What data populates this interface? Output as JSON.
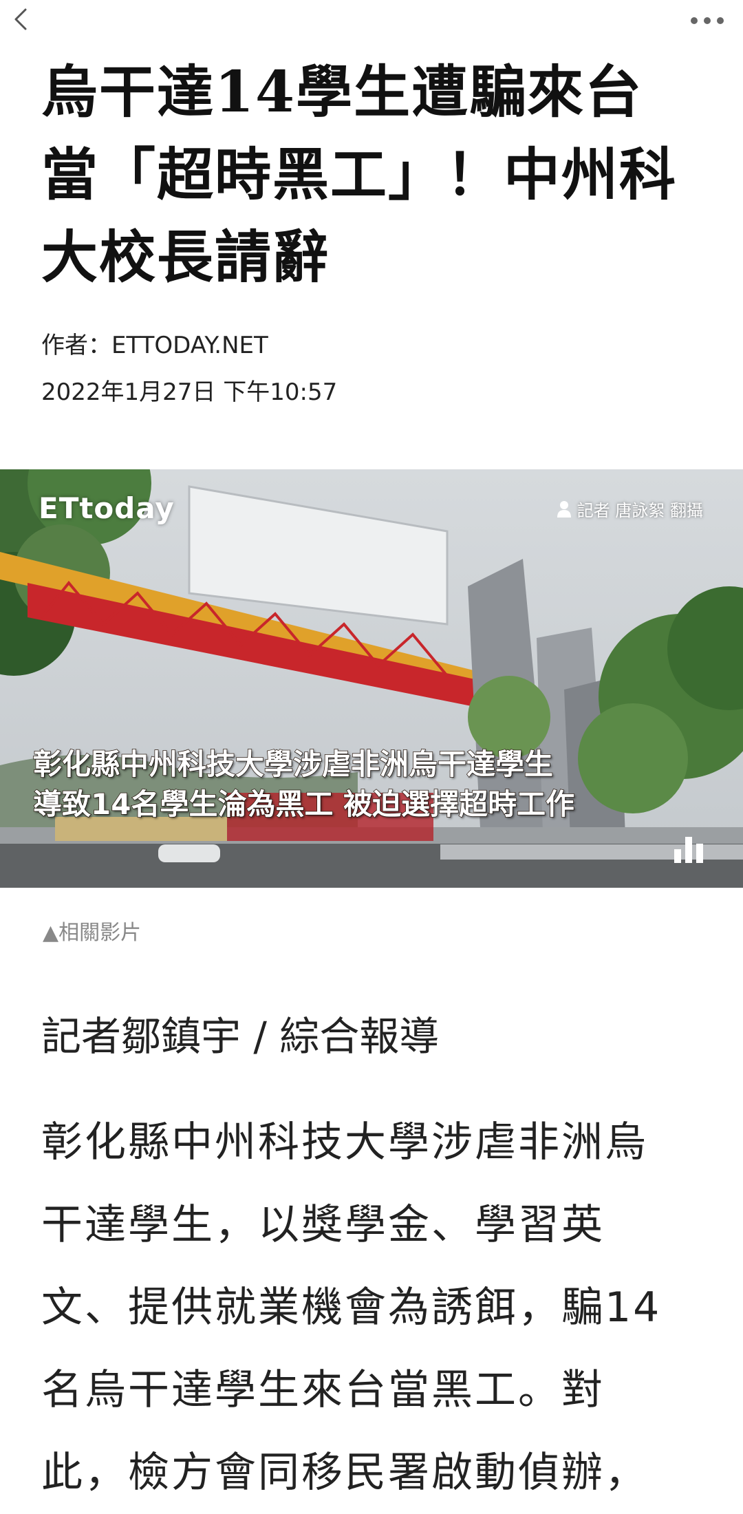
{
  "header": {
    "back_icon": "chevron-left-icon",
    "more_icon": "more-horizontal-icon"
  },
  "article": {
    "title_lines": [
      "烏干達14學生遭騙來台",
      "當「超時黑工」！中州科",
      "大校長請辭"
    ],
    "author": "作者：ETTODAY.NET",
    "date": "2022年1月27日 下午10:57"
  },
  "video": {
    "logo": "ETtoday",
    "credit": "記者 唐詠絮 翻攝",
    "caption_lines": [
      "彰化縣中州科技大學涉虐非洲烏干達學生",
      "導致14名學生淪為黑工 被迫選擇超時工作"
    ],
    "related_label": "▲相關影片"
  },
  "body": {
    "byline": "記者鄒鎮宇 / 綜合報導",
    "lines": [
      "彰化縣中州科技大學涉虐非洲烏",
      "干達學生，以獎學金、學習英",
      "文、提供就業機會為誘餌，騙14",
      "名烏干達學生來台當黑工。對",
      "此，檢方會同移民署啟動偵辦，"
    ]
  },
  "colors": {
    "text": "#111111",
    "muted": "#888888",
    "gate_red": "#c8262b",
    "gate_yellow": "#e0a12a"
  }
}
